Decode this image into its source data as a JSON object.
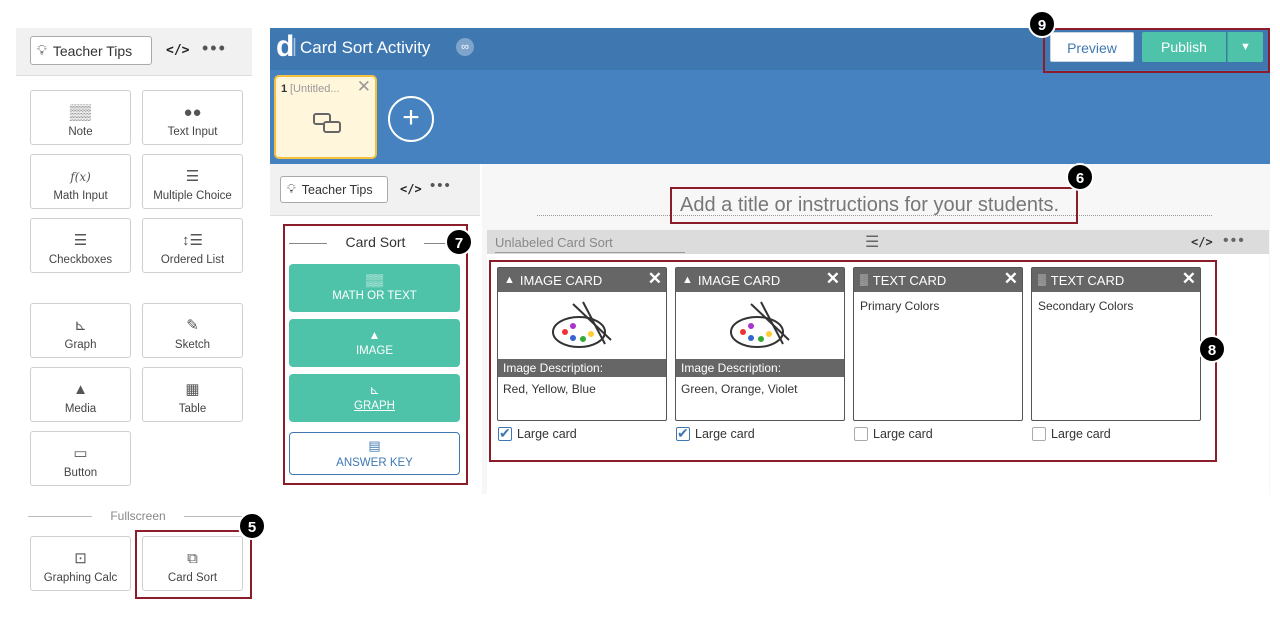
{
  "left_panel": {
    "teacher_tips": "Teacher Tips",
    "code_icon": "</>",
    "more": "•••",
    "tools": [
      {
        "label": "Note",
        "icon": "note-icon",
        "glyph": "▒▒"
      },
      {
        "label": "Text Input",
        "icon": "text-input-icon",
        "glyph": "●●"
      },
      {
        "label": "Math Input",
        "icon": "math-input-icon",
        "glyph": "f(x)"
      },
      {
        "label": "Multiple Choice",
        "icon": "multiple-choice-icon",
        "glyph": "☰"
      },
      {
        "label": "Checkboxes",
        "icon": "checkboxes-icon",
        "glyph": "☰"
      },
      {
        "label": "Ordered List",
        "icon": "ordered-list-icon",
        "glyph": "↕☰"
      },
      {
        "label": "Graph",
        "icon": "graph-icon",
        "glyph": "⊾"
      },
      {
        "label": "Sketch",
        "icon": "sketch-icon",
        "glyph": "✎"
      },
      {
        "label": "Media",
        "icon": "media-icon",
        "glyph": "▲"
      },
      {
        "label": "Table",
        "icon": "table-icon",
        "glyph": "▦"
      },
      {
        "label": "Button",
        "icon": "button-icon",
        "glyph": "▭"
      }
    ],
    "fullscreen_label": "Fullscreen",
    "fullscreen_tools": [
      {
        "label": "Graphing Calc",
        "icon": "graphing-calc-icon",
        "glyph": "⊡"
      },
      {
        "label": "Card Sort",
        "icon": "card-sort-icon",
        "glyph": "⧉"
      }
    ]
  },
  "header": {
    "logo": "d",
    "title": "Card Sort Activity",
    "link_icon": "🔗",
    "preview": "Preview",
    "publish": "Publish",
    "publish_dropdown": "▼"
  },
  "pages": {
    "page1": {
      "number": "1",
      "name": "[Untitled...",
      "close": "✕"
    },
    "add": "+"
  },
  "inner_panel": {
    "teacher_tips": "Teacher Tips",
    "code_icon": "</>",
    "more": "•••",
    "card_sort_title": "Card Sort",
    "buttons": [
      {
        "label": "MATH OR TEXT",
        "glyph": "▒▒"
      },
      {
        "label": "IMAGE",
        "glyph": "▲"
      },
      {
        "label": "GRAPH",
        "glyph": "⊾"
      }
    ],
    "answer_key": "ANSWER KEY"
  },
  "main": {
    "title_placeholder": "Add a title or instructions for your students.",
    "card_sort_name": "Unlabeled Card Sort",
    "menu_icon": "☰",
    "code_icon": "</>",
    "more": "•••",
    "cards": [
      {
        "type": "IMAGE CARD",
        "description_label": "Image Description:",
        "description": "Red, Yellow, Blue",
        "large": true,
        "large_label": "Large card"
      },
      {
        "type": "IMAGE CARD",
        "description_label": "Image Description:",
        "description": "Green, Orange, Violet",
        "large": true,
        "large_label": "Large card"
      },
      {
        "type": "TEXT CARD",
        "text": "Primary Colors",
        "large": false,
        "large_label": "Large card"
      },
      {
        "type": "TEXT CARD",
        "text": "Secondary Colors",
        "large": false,
        "large_label": "Large card"
      }
    ]
  },
  "callouts": [
    "5",
    "6",
    "7",
    "8",
    "9"
  ],
  "colors": {
    "header": "#3f78b1",
    "pages_bar": "#4682bf",
    "accent": "#4fc3a9",
    "callout_frame": "#8b1d2b"
  }
}
